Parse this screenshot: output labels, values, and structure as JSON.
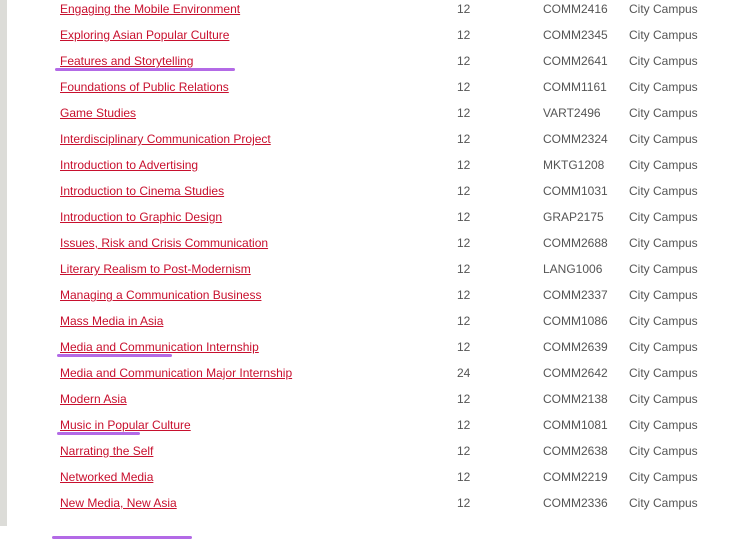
{
  "courses": [
    {
      "title": "Engaging the Mobile Environment",
      "credit_points": "12",
      "code": "COMM2416",
      "campus": "City Campus"
    },
    {
      "title": "Exploring Asian Popular Culture",
      "credit_points": "12",
      "code": "COMM2345",
      "campus": "City Campus",
      "highlighted": true
    },
    {
      "title": "Features and Storytelling",
      "credit_points": "12",
      "code": "COMM2641",
      "campus": "City Campus"
    },
    {
      "title": "Foundations of Public Relations",
      "credit_points": "12",
      "code": "COMM1161",
      "campus": "City Campus"
    },
    {
      "title": "Game Studies",
      "credit_points": "12",
      "code": "VART2496",
      "campus": "City Campus"
    },
    {
      "title": "Interdisciplinary Communication Project",
      "credit_points": "12",
      "code": "COMM2324",
      "campus": "City Campus"
    },
    {
      "title": "Introduction to Advertising",
      "credit_points": "12",
      "code": "MKTG1208",
      "campus": "City Campus"
    },
    {
      "title": "Introduction to Cinema Studies",
      "credit_points": "12",
      "code": "COMM1031",
      "campus": "City Campus"
    },
    {
      "title": "Introduction to Graphic Design",
      "credit_points": "12",
      "code": "GRAP2175",
      "campus": "City Campus"
    },
    {
      "title": "Issues, Risk and Crisis Communication",
      "credit_points": "12",
      "code": "COMM2688",
      "campus": "City Campus"
    },
    {
      "title": "Literary Realism to Post-Modernism",
      "credit_points": "12",
      "code": "LANG1006",
      "campus": "City Campus"
    },
    {
      "title": "Managing a Communication Business",
      "credit_points": "12",
      "code": "COMM2337",
      "campus": "City Campus"
    },
    {
      "title": "Mass Media in Asia",
      "credit_points": "12",
      "code": "COMM1086",
      "campus": "City Campus",
      "highlighted": true
    },
    {
      "title": "Media and Communication Internship",
      "credit_points": "12",
      "code": "COMM2639",
      "campus": "City Campus"
    },
    {
      "title": "Media and Communication Major Internship",
      "credit_points": "24",
      "code": "COMM2642",
      "campus": "City Campus"
    },
    {
      "title": "Modern Asia",
      "credit_points": "12",
      "code": "COMM2138",
      "campus": "City Campus",
      "highlighted": true
    },
    {
      "title": "Music in Popular Culture",
      "credit_points": "12",
      "code": "COMM1081",
      "campus": "City Campus"
    },
    {
      "title": "Narrating the Self",
      "credit_points": "12",
      "code": "COMM2638",
      "campus": "City Campus"
    },
    {
      "title": "Networked Media",
      "credit_points": "12",
      "code": "COMM2219",
      "campus": "City Campus"
    },
    {
      "title": "New Media, New Asia",
      "credit_points": "12",
      "code": "COMM2336",
      "campus": "City Campus",
      "highlighted": true
    }
  ],
  "colors": {
    "link": "#c8102e",
    "text": "#555555",
    "highlight": "#b36ae6"
  }
}
